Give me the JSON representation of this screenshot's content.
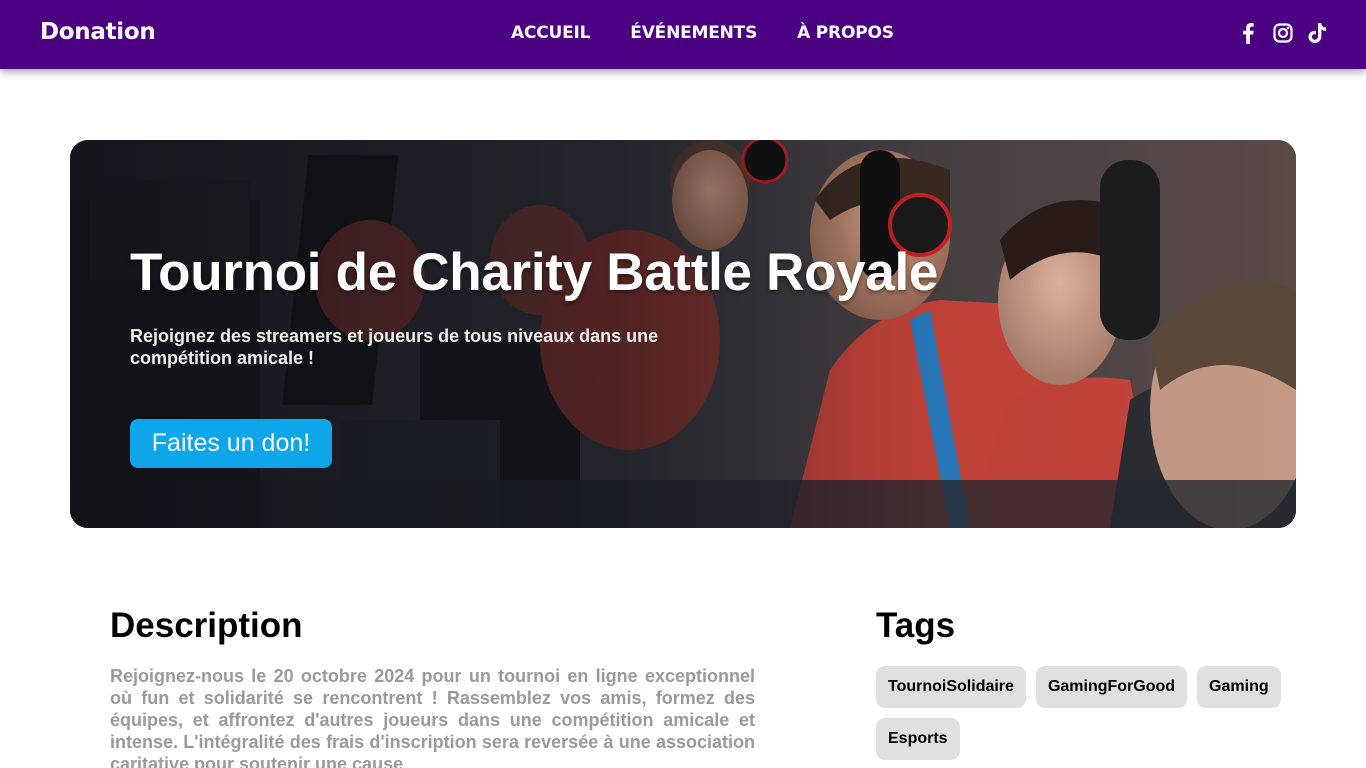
{
  "navbar": {
    "brand": "Donation",
    "links": [
      "ACCUEIL",
      "ÉVÉNEMENTS",
      "À PROPOS"
    ],
    "socials": [
      "facebook-icon",
      "instagram-icon",
      "tiktok-icon"
    ],
    "color": "#4b0082"
  },
  "hero": {
    "title": "Tournoi de Charity Battle Royale",
    "subtitle": "Rejoignez des streamers et joueurs de tous niveaux dans une compétition amicale !",
    "donate_button": "Faites un don!",
    "button_color": "#0ea5e9"
  },
  "description": {
    "title": "Description",
    "text": "Rejoignez-nous le 20 octobre 2024 pour un tournoi en ligne exceptionnel où fun et solidarité se rencontrent ! Rassemblez vos amis, formez des équipes, et affrontez d'autres joueurs dans une compétition amicale et intense. L'intégralité des frais d'inscription sera reversée à une association caritative pour soutenir une cause"
  },
  "tags": {
    "title": "Tags",
    "items": [
      "TournoiSolidaire",
      "GamingForGood",
      "Gaming",
      "Esports"
    ]
  }
}
